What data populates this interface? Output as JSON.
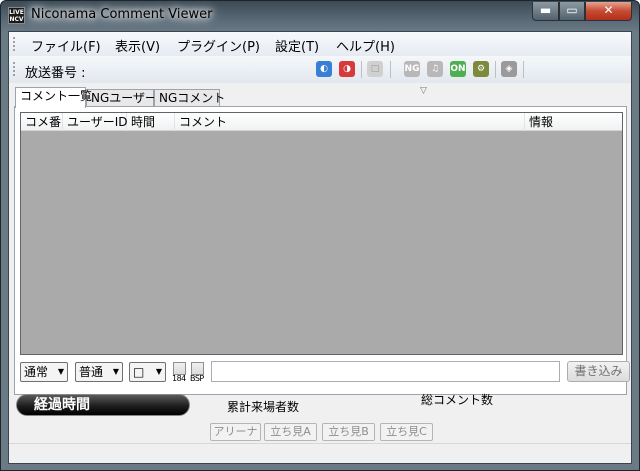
{
  "window": {
    "title": "Niconama Comment Viewer",
    "icon_text": [
      "LIVE",
      "NCV"
    ],
    "minimize": "▬",
    "maximize": "▭",
    "close": "✕"
  },
  "menu": {
    "items": [
      {
        "label": "ファイル(F)"
      },
      {
        "label": "表示(V)"
      },
      {
        "label": "プラグイン(P)"
      },
      {
        "label": "設定(T)"
      },
      {
        "label": "ヘルプ(H)"
      }
    ]
  },
  "toolbar": {
    "broadcast_label": "放送番号 :",
    "broadcast_value": "",
    "icons": [
      {
        "name": "connect-icon",
        "glyph": "◐",
        "color": "#3a7fd6"
      },
      {
        "name": "disconnect-icon",
        "glyph": "◑",
        "color": "#d63a3a"
      },
      {
        "name": "reconnect-icon",
        "glyph": "□",
        "color": "#c0c0c0"
      },
      {
        "name": "ng-icon",
        "glyph": "NG",
        "color": "#b8b8b8"
      },
      {
        "name": "speaker-icon",
        "glyph": "♫",
        "color": "#b8b8b8"
      },
      {
        "name": "on-air-icon",
        "glyph": "ON",
        "color": "#4caf50"
      },
      {
        "name": "gear-icon",
        "glyph": "⚙",
        "color": "#7d8a3d"
      },
      {
        "name": "plugin-icon",
        "glyph": "◈",
        "color": "#9a9a9a"
      }
    ]
  },
  "tabs": [
    {
      "label": "コメント一覧",
      "active": true
    },
    {
      "label": "NGユーザー",
      "active": false
    },
    {
      "label": "NGコメント",
      "active": false
    }
  ],
  "tab_overflow_icon": "▽",
  "comment_list": {
    "columns": [
      "コメ番",
      "ユーザーID",
      "時間",
      "コメント",
      "情報"
    ],
    "rows": []
  },
  "input_row": {
    "position_select": "通常",
    "size_select": "普通",
    "color_select": "□",
    "dropdown_arrow": "▼",
    "checkbox_184_label": "184",
    "checkbox_bsp_label": "BSP",
    "comment_value": "",
    "post_button": "書き込み"
  },
  "stats": {
    "elapsed_label": "経過時間",
    "visitors_label": "累計来場者数",
    "comments_label": "総コメント数"
  },
  "rooms": [
    "アリーナ",
    "立ち見A",
    "立ち見B",
    "立ち見C"
  ]
}
